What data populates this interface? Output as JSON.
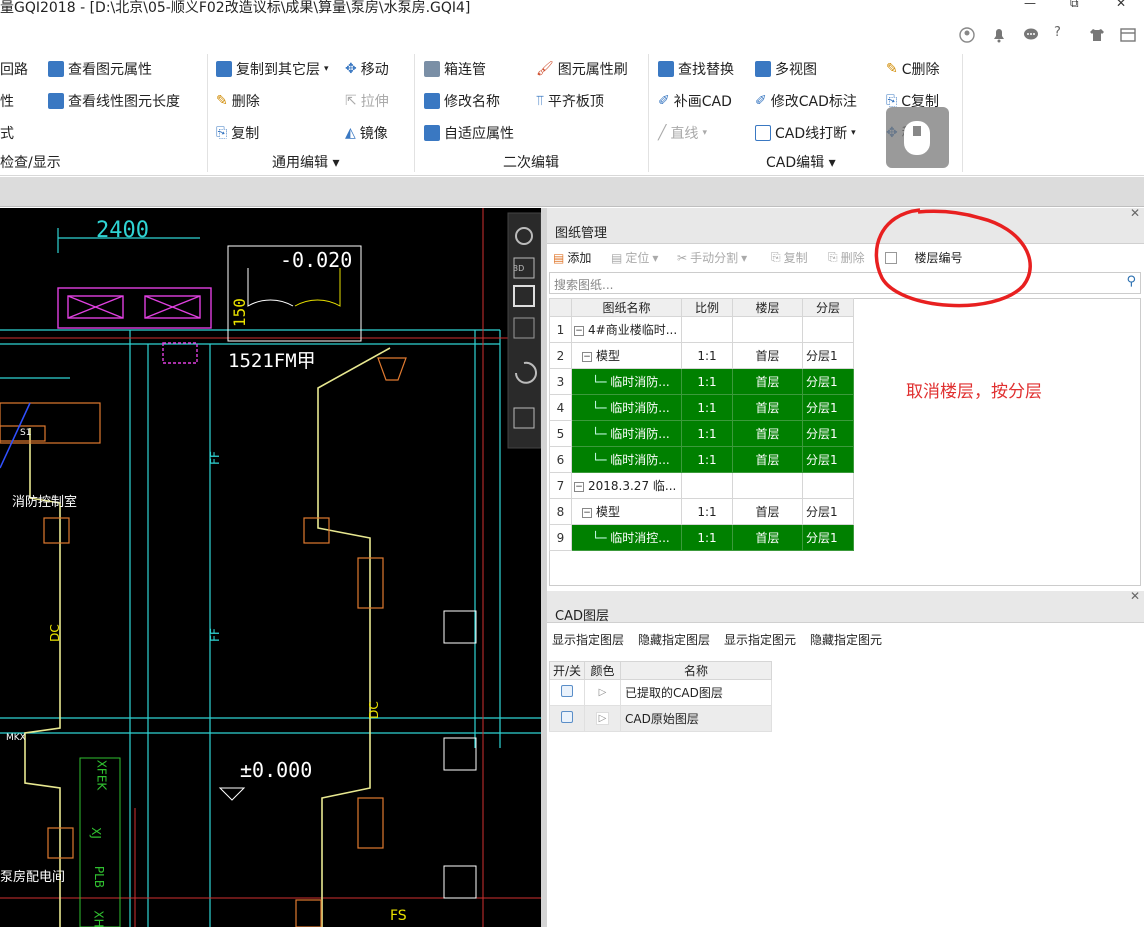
{
  "window": {
    "title": "量GQI2018 - [D:\\北京\\05-顺义F02改造议标\\成果\\算量\\泵房\\水泵房.GQI4]",
    "controls": [
      "—",
      "⧉",
      "✕"
    ]
  },
  "quick_toolbar": {
    "help": "?"
  },
  "ribbon": {
    "col1": [
      "回路",
      "性",
      "式"
    ],
    "col1_group": "检查/显示",
    "col1b": [
      "查看图元属性",
      "查看线性图元长度"
    ],
    "general_edit": {
      "items": [
        "复制到其它层",
        "移动",
        "删除",
        "拉伸",
        "复制",
        "镜像"
      ],
      "group": "通用编辑"
    },
    "secondary_edit": {
      "items": [
        "箱连管",
        "图元属性刷",
        "修改名称",
        "平齐板顶",
        "自适应属性"
      ],
      "group": "二次编辑"
    },
    "cad_edit": {
      "items": [
        "查找替换",
        "多视图",
        "C删除",
        "补画CAD",
        "修改CAD标注",
        "C复制",
        "直线",
        "CAD线打断",
        "移动"
      ],
      "group": "CAD编辑"
    }
  },
  "drawing_panel": {
    "title": "图纸管理",
    "toolbar": [
      "添加",
      "定位",
      "手动分割",
      "复制",
      "删除"
    ],
    "checkbox_label": "楼层编号",
    "search_placeholder": "搜索图纸...",
    "columns": [
      "图纸名称",
      "比例",
      "楼层",
      "分层"
    ],
    "rows": [
      {
        "n": "1",
        "name": "4#商业楼临时...",
        "scale": "",
        "floor": "",
        "layer": "",
        "level": 0,
        "hl": false
      },
      {
        "n": "2",
        "name": "模型",
        "scale": "1:1",
        "floor": "首层",
        "layer": "分层1",
        "level": 1,
        "hl": false
      },
      {
        "n": "3",
        "name": "临时消防...",
        "scale": "1:1",
        "floor": "首层",
        "layer": "分层1",
        "level": 2,
        "hl": true
      },
      {
        "n": "4",
        "name": "临时消防...",
        "scale": "1:1",
        "floor": "首层",
        "layer": "分层1",
        "level": 2,
        "hl": true
      },
      {
        "n": "5",
        "name": "临时消防...",
        "scale": "1:1",
        "floor": "首层",
        "layer": "分层1",
        "level": 2,
        "hl": true
      },
      {
        "n": "6",
        "name": "临时消防...",
        "scale": "1:1",
        "floor": "首层",
        "layer": "分层1",
        "level": 2,
        "hl": true
      },
      {
        "n": "7",
        "name": "2018.3.27 临...",
        "scale": "",
        "floor": "",
        "layer": "",
        "level": 0,
        "hl": false
      },
      {
        "n": "8",
        "name": "模型",
        "scale": "1:1",
        "floor": "首层",
        "layer": "分层1",
        "level": 1,
        "hl": false
      },
      {
        "n": "9",
        "name": "临时消控...",
        "scale": "1:1",
        "floor": "首层",
        "layer": "分层1",
        "level": 2,
        "hl": true
      }
    ],
    "annotation": "取消楼层，按分层"
  },
  "cad_layer_panel": {
    "title": "CAD图层",
    "actions": [
      "显示指定图层",
      "隐藏指定图层",
      "显示指定图元",
      "隐藏指定图元"
    ],
    "columns": [
      "开/关",
      "颜色",
      "名称"
    ],
    "rows": [
      "已提取的CAD图层",
      "CAD原始图层"
    ]
  },
  "cad_canvas": {
    "dims": [
      "2400",
      "-0.020",
      "150",
      "1521FM甲",
      "±0.000"
    ],
    "labels": [
      "FF",
      "FF",
      "DC",
      "DC",
      "FS",
      "消防控制室",
      "泵房配电间",
      "S1",
      "MKX",
      "XFEK",
      "XJ",
      "PLB",
      "XH"
    ],
    "nav": [
      "3D"
    ]
  },
  "colors": {
    "highlight": "#008000",
    "annotation": "#e03030",
    "cad_bg": "#000000"
  }
}
